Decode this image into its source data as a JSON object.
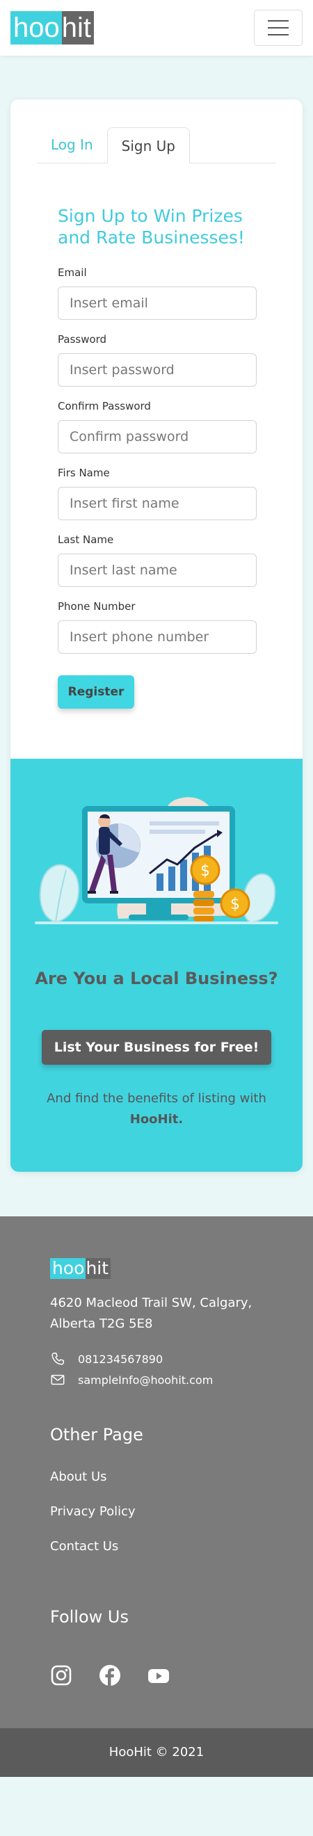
{
  "navbar": {
    "logo_part1": "hoo",
    "logo_part2": "hit",
    "menu_icon": "hamburger-icon"
  },
  "auth": {
    "tabs": [
      {
        "label": "Log In",
        "active": false
      },
      {
        "label": "Sign Up",
        "active": true
      }
    ],
    "heading": "Sign Up to Win Prizes and Rate Businesses!",
    "fields": [
      {
        "label": "Email",
        "placeholder": "Insert email",
        "value": ""
      },
      {
        "label": "Password",
        "placeholder": "Insert password",
        "value": ""
      },
      {
        "label": "Confirm Password",
        "placeholder": "Confirm password",
        "value": ""
      },
      {
        "label": "Firs Name",
        "placeholder": "Insert first name",
        "value": ""
      },
      {
        "label": "Last Name",
        "placeholder": "Insert last name",
        "value": ""
      },
      {
        "label": "Phone Number",
        "placeholder": "Insert phone number",
        "value": ""
      }
    ],
    "register_label": "Register"
  },
  "business": {
    "heading": "Are You a Local Business?",
    "button_label": "List Your Business for Free!",
    "text": "And find the benefits of listing with",
    "brand": "HooHit."
  },
  "footer": {
    "logo_part1": "hoo",
    "logo_part2": "hit",
    "address": "4620 Macleod Trail SW, Calgary, Alberta T2G 5E8",
    "phone": "081234567890",
    "email": "sampleInfo@hoohit.com",
    "other_title": "Other Page",
    "links": [
      "About Us",
      "Privacy Policy",
      "Contact Us"
    ],
    "follow_title": "Follow Us",
    "social_icons": [
      "instagram-icon",
      "facebook-icon",
      "youtube-icon"
    ],
    "copyright": "HooHit © 2021"
  },
  "colors": {
    "accent": "#40d4df",
    "dark": "#5d5d5d",
    "footer_bg": "#7b7b7b",
    "copyright_bg": "#5b5b5b",
    "page_bg": "#eaf7f7"
  }
}
